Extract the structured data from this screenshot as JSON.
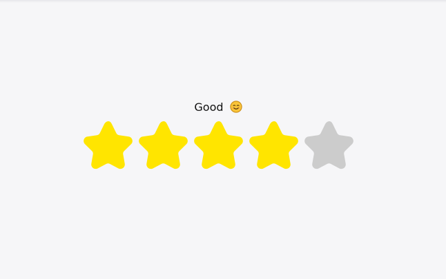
{
  "rating": {
    "label": "Good",
    "emoji_icon": "smiling-face-icon",
    "value": 4,
    "max": 5,
    "filled_color": "#FFE500",
    "empty_color": "#CCCCCC",
    "stars": [
      {
        "icon": "star-icon",
        "filled": true
      },
      {
        "icon": "star-icon",
        "filled": true
      },
      {
        "icon": "star-icon",
        "filled": true
      },
      {
        "icon": "star-icon",
        "filled": true
      },
      {
        "icon": "star-icon",
        "filled": false
      }
    ]
  }
}
